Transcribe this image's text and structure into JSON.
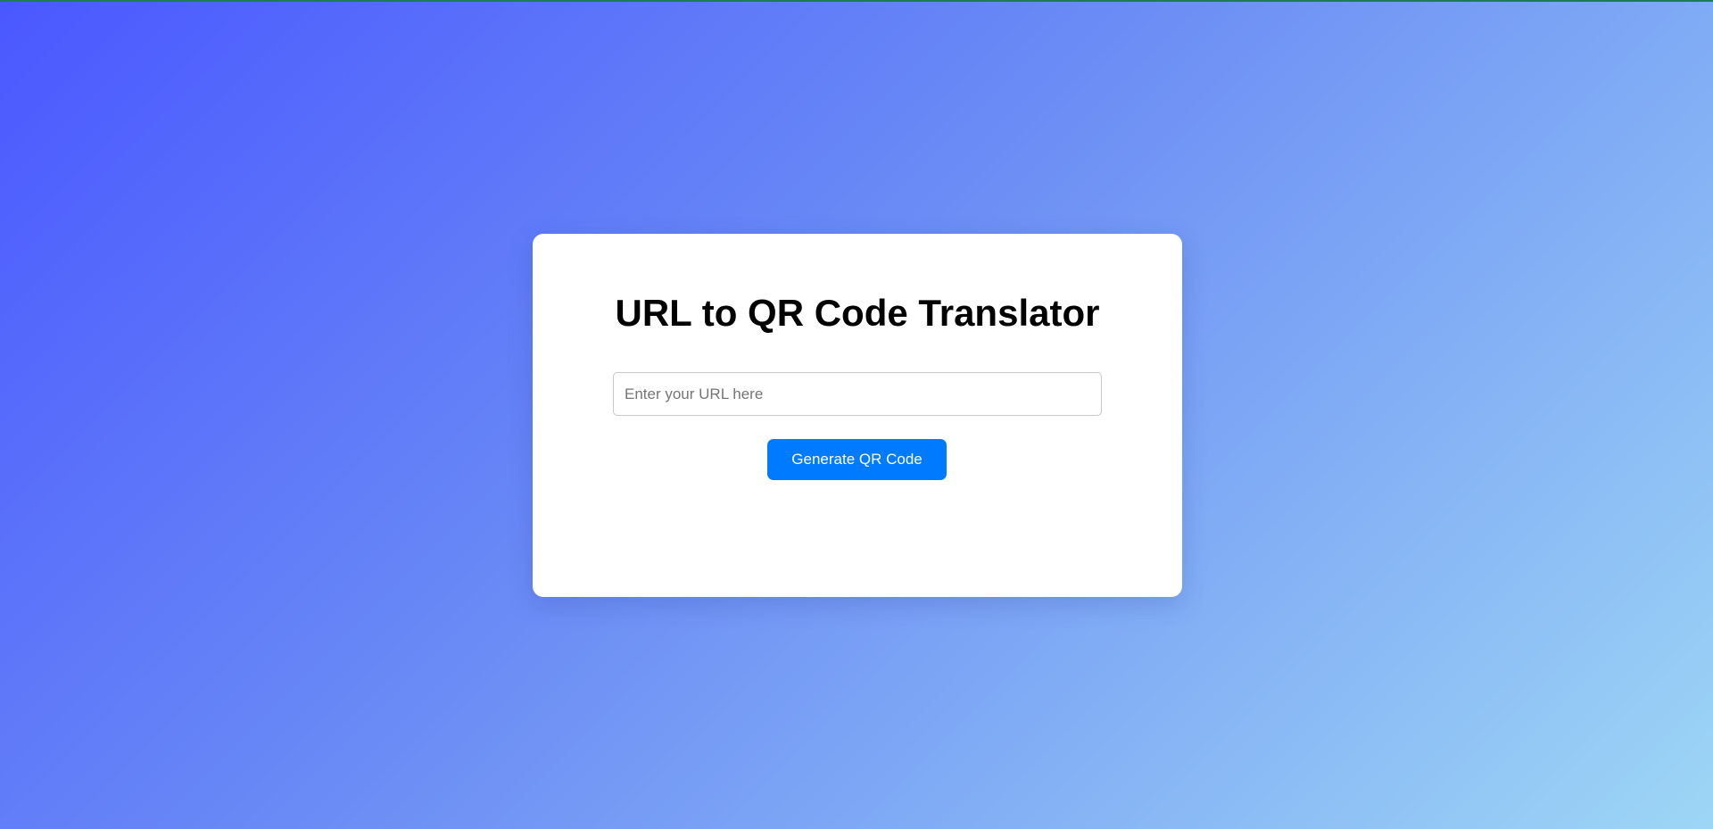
{
  "page": {
    "title": "URL to QR Code Translator"
  },
  "form": {
    "url_input": {
      "value": "",
      "placeholder": "Enter your URL here"
    },
    "generate_label": "Generate QR Code"
  },
  "colors": {
    "accent": "#007bff",
    "card_background": "#ffffff",
    "background_gradient_start": "#4a58ff",
    "background_gradient_end": "#9dd6f5"
  }
}
